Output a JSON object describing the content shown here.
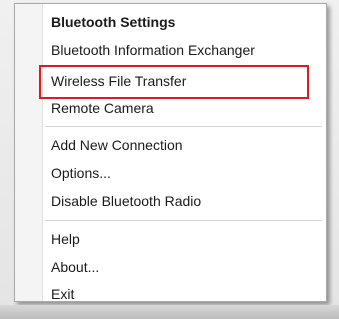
{
  "menu": {
    "section1": [
      {
        "label": "Bluetooth Settings",
        "bold": true
      },
      {
        "label": "Bluetooth Information Exchanger"
      },
      {
        "label": "Wireless File Transfer",
        "highlighted": true
      },
      {
        "label": "Remote Camera"
      }
    ],
    "section2": [
      {
        "label": "Add New Connection"
      },
      {
        "label": "Options..."
      },
      {
        "label": "Disable Bluetooth Radio"
      }
    ],
    "section3": [
      {
        "label": "Help"
      },
      {
        "label": "About..."
      },
      {
        "label": "Exit"
      }
    ]
  },
  "colors": {
    "highlight_outline": "#e01b1b",
    "menu_background": "#ffffff"
  }
}
